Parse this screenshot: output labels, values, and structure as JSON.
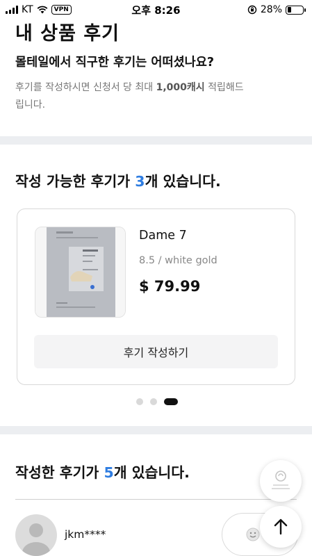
{
  "status_bar": {
    "carrier": "KT",
    "vpn": "VPN",
    "time": "오후 8:26",
    "battery": "28%",
    "battery_level": 0.28
  },
  "header": {
    "title": "내 상품 후기",
    "subtitle": "몰테일에서 직구한 후기는 어떠셨나요?",
    "notice_pre": "후기를 작성하시면 신청서 당 최대 ",
    "notice_bold": "1,000캐시",
    "notice_post": " 적립해드립니다."
  },
  "writable": {
    "title_pre": "작성 가능한 후기가 ",
    "count": "3",
    "title_post": "개 있습니다.",
    "product": {
      "name": "Dame 7",
      "option": "8.5 / white gold",
      "price": "$ 79.99"
    },
    "write_button": "후기 작성하기",
    "pager": {
      "pages": 3,
      "active": 3
    }
  },
  "written": {
    "title_pre": "작성한 후기가 ",
    "count": "5",
    "title_post": "개 있습니다.",
    "review": {
      "username": "jkm****"
    }
  },
  "icons": {
    "avatar": "avatar-placeholder-icon",
    "reaction": "smile-icon",
    "assist": "assist-icon",
    "top": "arrow-up-icon"
  },
  "colors": {
    "accent": "#2f7de1",
    "band": "#eceef1",
    "button_bg": "#f4f4f5"
  }
}
